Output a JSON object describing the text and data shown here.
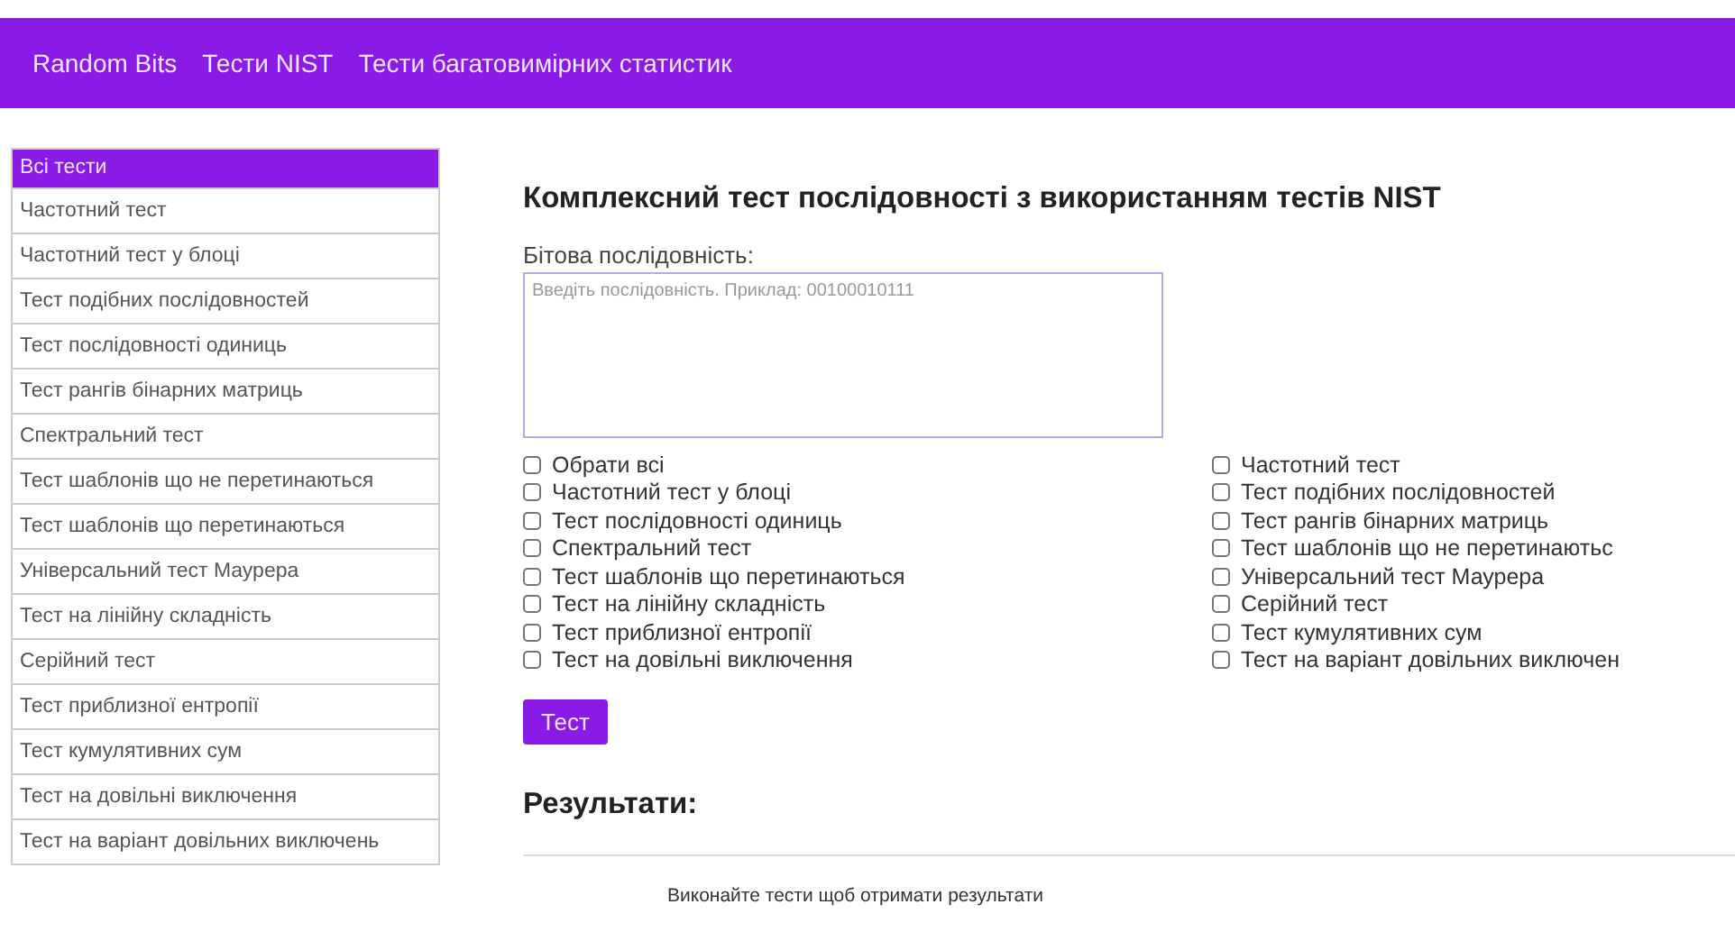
{
  "navbar": {
    "items": [
      {
        "label": "Random Bits"
      },
      {
        "label": "Тести NIST"
      },
      {
        "label": "Тести багатовимірних статистик"
      }
    ]
  },
  "sidebar": {
    "items": [
      {
        "label": "Всі тести",
        "selected": true
      },
      {
        "label": "Частотний тест",
        "selected": false
      },
      {
        "label": "Частотний тест у блоці",
        "selected": false
      },
      {
        "label": "Тест подібних послідовностей",
        "selected": false
      },
      {
        "label": "Тест послідовності одиниць",
        "selected": false
      },
      {
        "label": "Тест рангів бінарних матриць",
        "selected": false
      },
      {
        "label": "Спектральний тест",
        "selected": false
      },
      {
        "label": "Тест шаблонів що не перетинаються",
        "selected": false
      },
      {
        "label": "Тест шаблонів що перетинаються",
        "selected": false
      },
      {
        "label": "Універсальний тест Маурера",
        "selected": false
      },
      {
        "label": "Тест на лінійну складність",
        "selected": false
      },
      {
        "label": "Серійний тест",
        "selected": false
      },
      {
        "label": "Тест приблизної ентропії",
        "selected": false
      },
      {
        "label": "Тест кумулятивних сум",
        "selected": false
      },
      {
        "label": "Тест на довільні виключення",
        "selected": false
      },
      {
        "label": "Тест на варіант довільних виключень",
        "selected": false
      }
    ]
  },
  "main": {
    "title": "Комплексний тест послідовності з використанням тестів NIST",
    "sequence_label": "Бітова послідовність:",
    "sequence_field": {
      "placeholder": "Введіть послідовність. Приклад: 00100010111"
    },
    "checkboxes": {
      "left": [
        {
          "label": "Обрати всі",
          "checked": false
        },
        {
          "label": "Частотний тест у блоці",
          "checked": false
        },
        {
          "label": "Тест послідовності одиниць",
          "checked": false
        },
        {
          "label": "Спектральний тест",
          "checked": false
        },
        {
          "label": "Тест шаблонів що перетинаються",
          "checked": false
        },
        {
          "label": "Тест на лінійну складність",
          "checked": false
        },
        {
          "label": "Тест приблизної ентропії",
          "checked": false
        },
        {
          "label": "Тест на довільні виключення",
          "checked": false
        }
      ],
      "right": [
        {
          "label": "Частотний тест",
          "checked": false
        },
        {
          "label": "Тест подібних послідовностей",
          "checked": false
        },
        {
          "label": "Тест рангів бінарних матриць",
          "checked": false
        },
        {
          "label": "Тест шаблонів що не перетинаютьс",
          "checked": false
        },
        {
          "label": "Універсальний тест Маурера",
          "checked": false
        },
        {
          "label": "Серійний тест",
          "checked": false
        },
        {
          "label": "Тест кумулятивних сум",
          "checked": false
        },
        {
          "label": "Тест на варіант довільних виключен",
          "checked": false
        }
      ]
    },
    "test_button": "Тест",
    "results_heading": "Результати:",
    "results_message": "Виконайте тести щоб отримати результати"
  }
}
